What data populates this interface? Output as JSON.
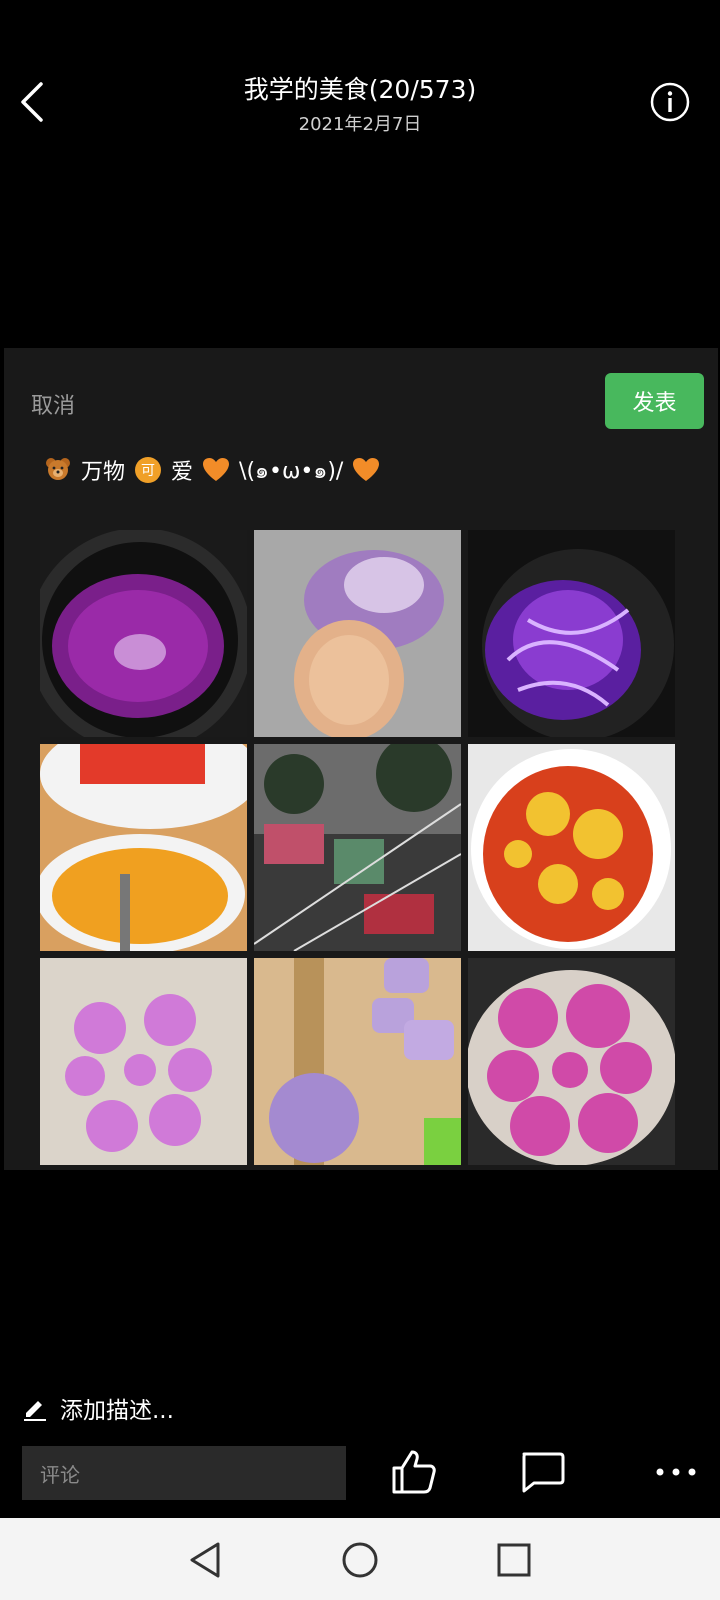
{
  "header": {
    "title": "我学的美食(20/573)",
    "date": "2021年2月7日"
  },
  "post": {
    "cancel_label": "取消",
    "publish_label": "发表",
    "text_segments": [
      "万物",
      "爱",
      "\\(๑•ω•๑)/"
    ],
    "emoji_icons": [
      "teddy-bear-icon",
      "ke-character-emoji-icon",
      "orange-heart-icon",
      "orange-heart-icon"
    ]
  },
  "photos": [
    "purple-syrup-in-wok",
    "purple-dough-kneading",
    "purple-cabbage-boiling",
    "tomato-and-egg-bowls",
    "window-reflection",
    "tomato-egg-stir-fry",
    "purple-flower-buns-raw",
    "purple-dough-rolling",
    "purple-flower-buns-steamed"
  ],
  "bottom": {
    "add_description": "添加描述...",
    "comment_placeholder": "评论"
  },
  "colors": {
    "accent": "#48b85d",
    "background": "#000000",
    "card": "#191919"
  }
}
